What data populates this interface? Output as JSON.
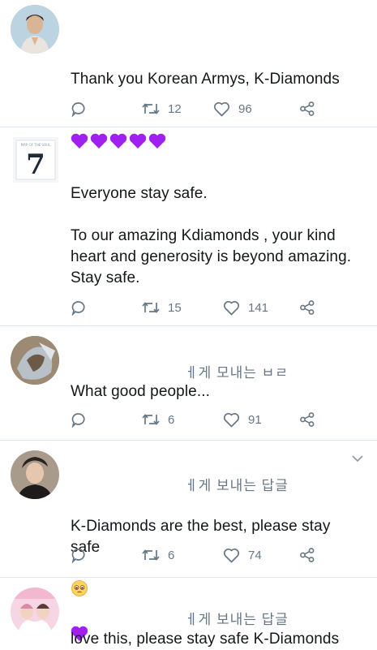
{
  "tweets": [
    {
      "text": "Thank you Korean Armys, K-Diamonds",
      "hearts": 5,
      "retweets": "12",
      "likes": "96"
    },
    {
      "text": "Everyone stay safe.\n\nTo our amazing Kdiamonds , your kind heart and generosity is beyond amazing. Stay safe.",
      "retweets": "15",
      "likes": "141"
    },
    {
      "reply_header": "ㅔ게 모내는 ㅂㄹ",
      "text": "What good people...",
      "retweets": "6",
      "likes": "91"
    },
    {
      "reply_header": "ㅔ게 보내는 답글",
      "text": "K-Diamonds are the best, please stay safe",
      "retweets": "6",
      "likes": "74"
    },
    {
      "reply_header": "ㅔ게 보내는 답글",
      "text": "love this, please stay safe K-Diamonds"
    }
  ],
  "colors": {
    "icon_gray": "#657786",
    "heart_purple": "#a020f0",
    "divider": "#e1e8ed"
  },
  "icons": [
    "reply-icon",
    "retweet-icon",
    "like-icon",
    "share-icon",
    "purple-heart-emoji",
    "pleading-face-emoji",
    "chevron-down-icon"
  ]
}
